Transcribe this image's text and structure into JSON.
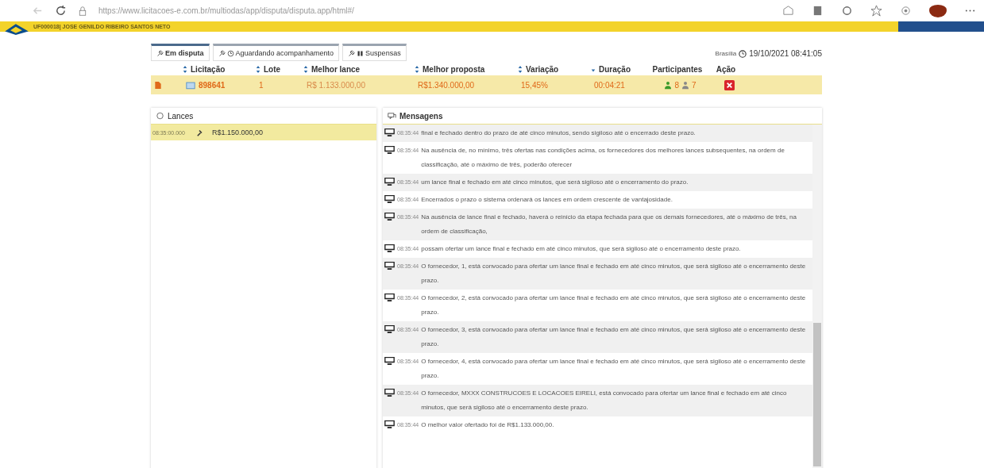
{
  "browser": {
    "url": "https://www.licitacoes-e.com.br/multiodas/app/disputa/disputa.app/html#/"
  },
  "banner": {
    "user": "UF000018| JOSE GENILDO RIBEIRO SANTOS NETO"
  },
  "tabs": [
    {
      "label": "Em disputa",
      "selected": true
    },
    {
      "label": "Aguardando acompanhamento",
      "selected": false
    },
    {
      "label": "Suspensas",
      "selected": false
    }
  ],
  "clock": {
    "city": "Brasília",
    "datetime": "19/10/2021 08:41:05"
  },
  "table": {
    "columns": [
      "Licitação",
      "Lote",
      "Melhor lance",
      "Melhor proposta",
      "Variação",
      "Duração",
      "Participantes",
      "Ação"
    ],
    "rows": [
      {
        "licitacao": "898641",
        "lote": "1",
        "melhor_lance": "R$ 1.133.000,00",
        "melhor_proposta": "R$1.340.000,00",
        "variacao": "15,45%",
        "duracao": "00:04:21",
        "participants_active": "8",
        "participants_inactive": "7",
        "selected": true
      }
    ]
  },
  "lances": {
    "title": "Lances",
    "items": [
      {
        "time": "08:35:00.000",
        "value": "R$1.150.000,00",
        "selected": true
      }
    ]
  },
  "mensagens": {
    "title": "Mensagens",
    "items": [
      {
        "time": "08:35:44",
        "text": "final e fechado dentro do prazo de até cinco minutos, sendo sigiloso até o encerrado deste prazo."
      },
      {
        "time": "08:35:44",
        "text": "Na ausência de, no mínimo, três ofertas nas condições acima, os fornecedores dos melhores lances subsequentes, na ordem de classificação, até o máximo de três, poderão oferecer"
      },
      {
        "time": "08:35:44",
        "text": "um lance final e fechado em até cinco minutos, que será sigiloso até o encerramento do prazo."
      },
      {
        "time": "08:35:44",
        "text": "Encerrados o prazo o sistema ordenará os lances em ordem crescente de vantajosidade."
      },
      {
        "time": "08:35:44",
        "text": "Na ausência de lance final e fechado, haverá o reinício da etapa fechada para que os demais fornecedores, até o máximo de três, na ordem de classificação,"
      },
      {
        "time": "08:35:44",
        "text": "possam ofertar um lance final e fechado em até cinco minutos, que será sigiloso até o encerramento deste prazo."
      },
      {
        "time": "08:35:44",
        "text": "O fornecedor, 1, está convocado para ofertar um lance final e fechado em até cinco minutos, que será sigiloso até o encerramento deste prazo."
      },
      {
        "time": "08:35:44",
        "text": "O fornecedor, 2, está convocado para ofertar um lance final e fechado em até cinco minutos, que será sigiloso até o encerramento deste prazo."
      },
      {
        "time": "08:35:44",
        "text": "O fornecedor, 3, está convocado para ofertar um lance final e fechado em até cinco minutos, que será sigiloso até o encerramento deste prazo."
      },
      {
        "time": "08:35:44",
        "text": "O fornecedor, 4, está convocado para ofertar um lance final e fechado em até cinco minutos, que será sigiloso até o encerramento deste prazo."
      },
      {
        "time": "08:35:44",
        "text": "O fornecedor, MXXX CONSTRUCOES E LOCACOES EIRELI, está convocado para ofertar um lance final e fechado em até cinco minutos, que será sigiloso até o encerramento deste prazo."
      },
      {
        "time": "08:35:44",
        "text": "O melhor valor ofertado foi de R$1.133.000,00."
      }
    ]
  }
}
